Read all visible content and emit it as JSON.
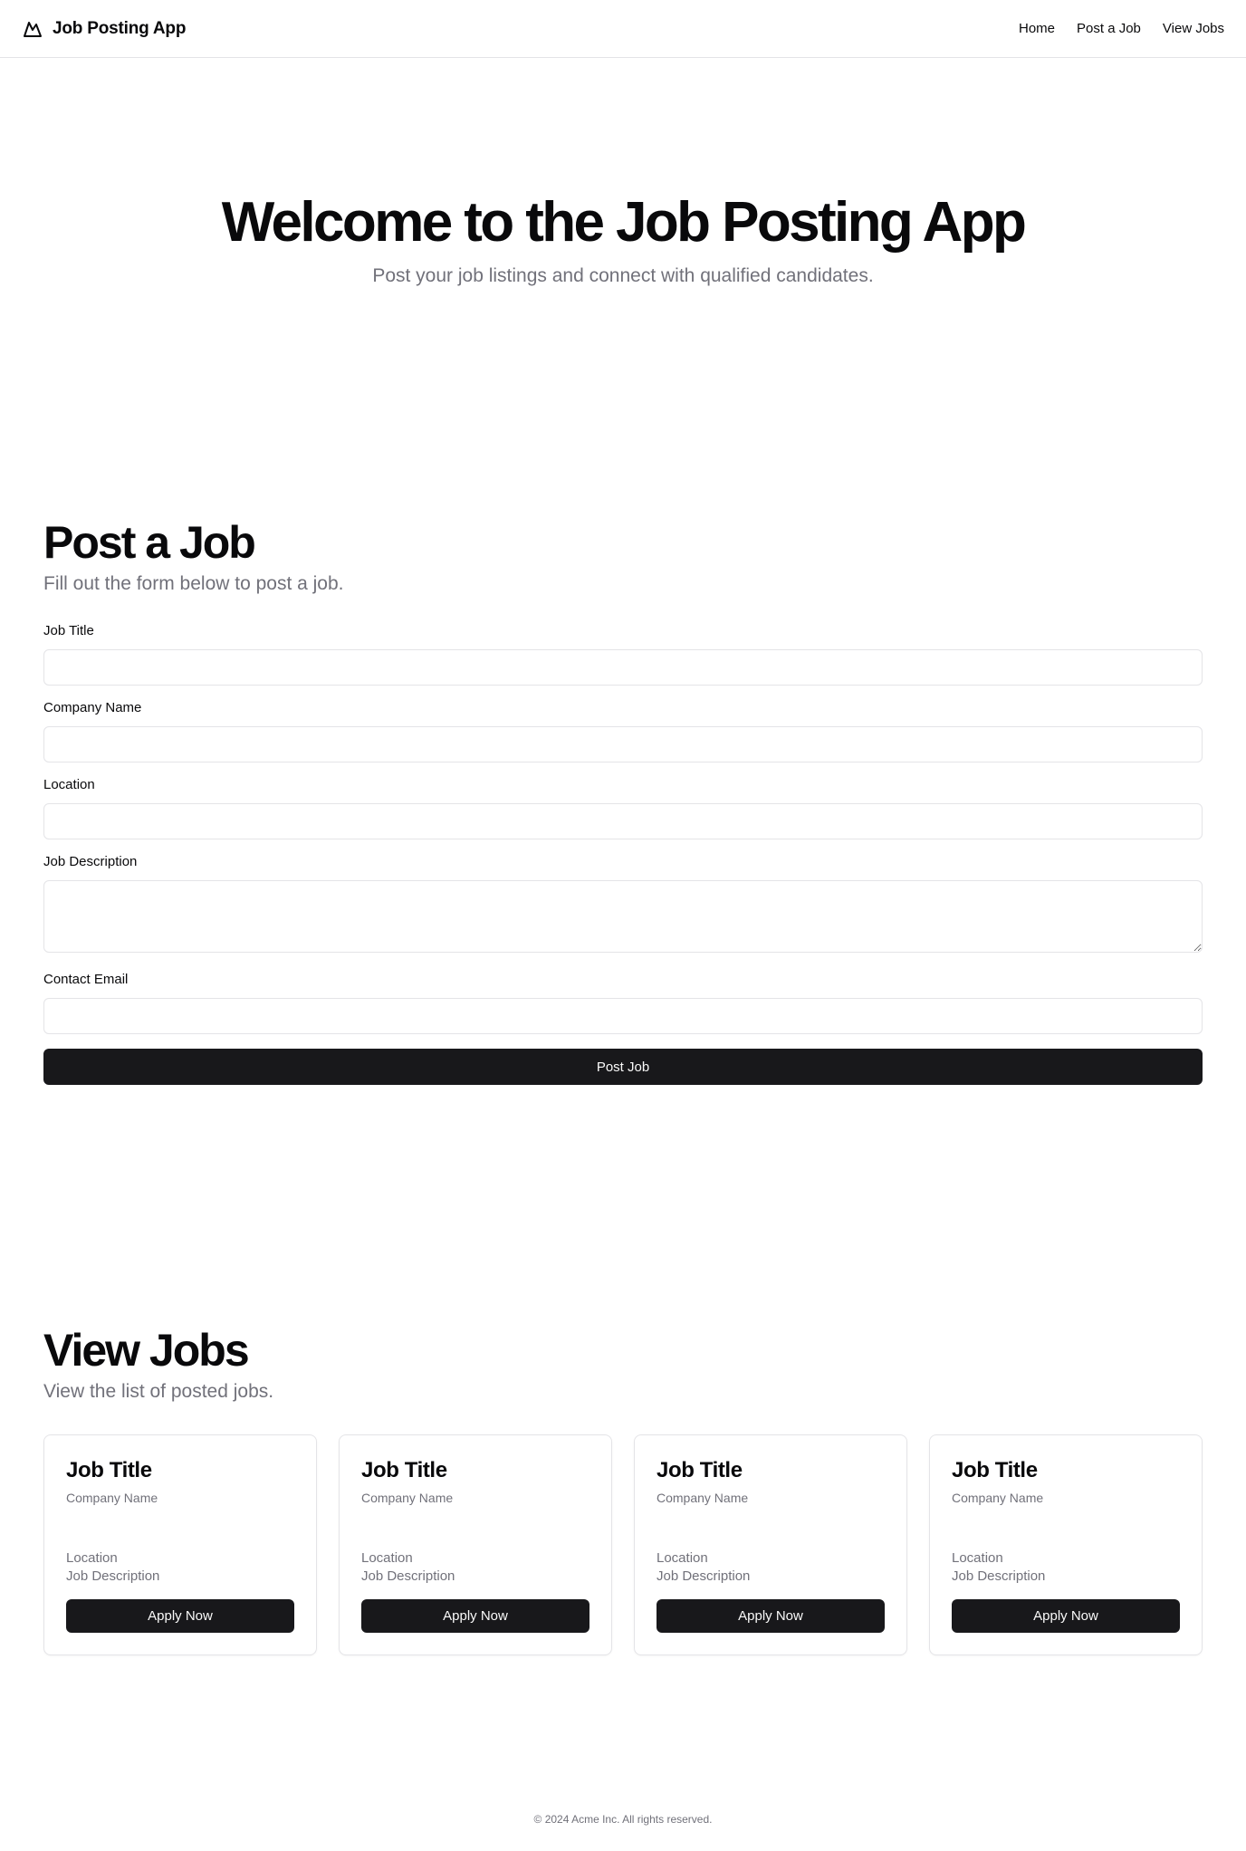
{
  "header": {
    "brand": "Job Posting App",
    "nav": [
      {
        "label": "Home"
      },
      {
        "label": "Post a Job"
      },
      {
        "label": "View Jobs"
      }
    ]
  },
  "hero": {
    "title": "Welcome to the Job Posting App",
    "subtitle": "Post your job listings and connect with qualified candidates."
  },
  "post": {
    "title": "Post a Job",
    "subtitle": "Fill out the form below to post a job.",
    "fields": {
      "job_title": {
        "label": "Job Title",
        "value": ""
      },
      "company_name": {
        "label": "Company Name",
        "value": ""
      },
      "location": {
        "label": "Location",
        "value": ""
      },
      "job_description": {
        "label": "Job Description",
        "value": ""
      },
      "contact_email": {
        "label": "Contact Email",
        "value": ""
      }
    },
    "submit_label": "Post Job"
  },
  "view": {
    "title": "View Jobs",
    "subtitle": "View the list of posted jobs.",
    "jobs": [
      {
        "title": "Job Title",
        "company": "Company Name",
        "location": "Location",
        "description": "Job Description",
        "button": "Apply Now"
      },
      {
        "title": "Job Title",
        "company": "Company Name",
        "location": "Location",
        "description": "Job Description",
        "button": "Apply Now"
      },
      {
        "title": "Job Title",
        "company": "Company Name",
        "location": "Location",
        "description": "Job Description",
        "button": "Apply Now"
      },
      {
        "title": "Job Title",
        "company": "Company Name",
        "location": "Location",
        "description": "Job Description",
        "button": "Apply Now"
      }
    ]
  },
  "footer": {
    "text": "© 2024 Acme Inc. All rights reserved."
  },
  "colors": {
    "primary": "#18181b",
    "muted_text": "#71717a",
    "border": "#e4e4e7"
  }
}
